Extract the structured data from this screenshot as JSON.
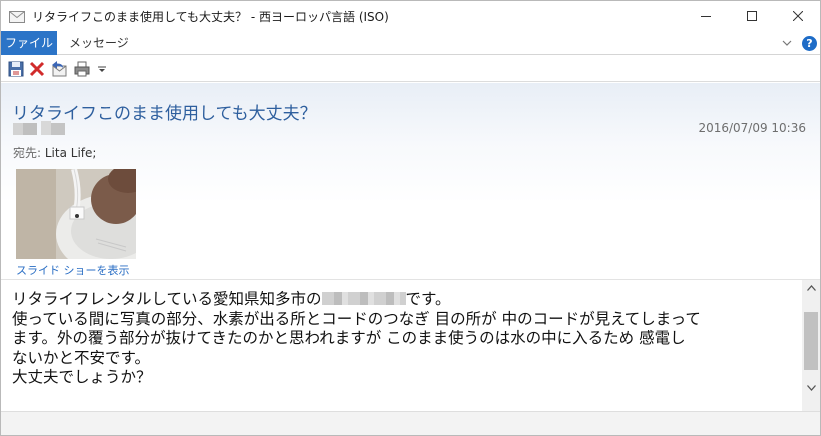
{
  "window": {
    "title": "リタライフこのまま使用しても大丈夫？ - 西ヨーロッパ言語 (ISO)",
    "controls": [
      "minimize-icon",
      "maximize-icon",
      "close-icon"
    ]
  },
  "ribbon": {
    "tabs": [
      {
        "label": "ファイル",
        "active": true
      },
      {
        "label": "メッセージ",
        "active": false
      }
    ],
    "help_label": "?"
  },
  "toolbar": {
    "icons": [
      "save-icon",
      "delete-icon",
      "reply-icon",
      "print-icon",
      "customize-dropdown-icon"
    ]
  },
  "message": {
    "subject": "リタライフこのまま使用しても大丈夫？",
    "date": "2016/07/09 10:36",
    "to_label": "宛先:",
    "to_value": "Lita Life;",
    "slideshow_link": "スライド ショーを表示",
    "body_lines": {
      "line1_before": "リタライフレンタルしている愛知県知多市の",
      "line1_after": "です。",
      "line2": "使っている間に写真の部分、水素が出る所とコードのつなぎ 目の所が 中のコードが見えてしまって",
      "line3": "ます。外の覆う部分が抜けてきたのかと思われますが このまま使うのは水の中に入るため 感電し",
      "line4": "ないかと不安です。",
      "line5": "大丈夫でしょうか？"
    }
  },
  "colors": {
    "accent": "#2b74c7",
    "subject": "#2e5f9e",
    "link": "#2a6ec4"
  }
}
